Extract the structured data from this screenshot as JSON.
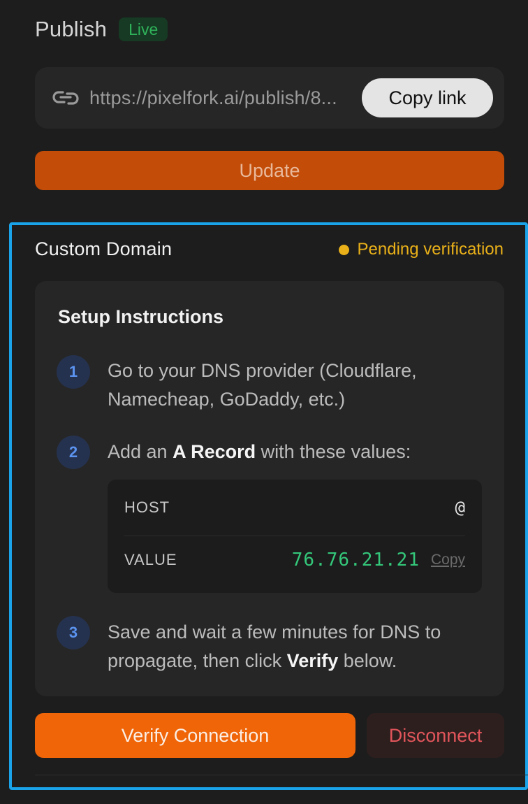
{
  "publish": {
    "title": "Publish",
    "status_badge": "Live",
    "url": "https://pixelfork.ai/publish/8...",
    "copy_link_label": "Copy link",
    "update_label": "Update",
    "link_icon": "link-chain-icon"
  },
  "custom_domain": {
    "title": "Custom Domain",
    "status": "Pending verification",
    "status_color": "#e9b019",
    "setup": {
      "title": "Setup Instructions",
      "steps": [
        {
          "number": "1",
          "text": "Go to your DNS provider (Cloudflare, Namecheap, GoDaddy, etc.)"
        },
        {
          "number": "2",
          "text_before": "Add an ",
          "text_bold": "A Record",
          "text_after": " with these values:"
        },
        {
          "number": "3",
          "text_before": "Save and wait a few minutes for DNS to propagate, then click ",
          "text_bold": "Verify",
          "text_after": " below."
        }
      ],
      "dns_record": {
        "host_label": "HOST",
        "host_value": "@",
        "value_label": "VALUE",
        "value": "76.76.21.21",
        "copy_label": "Copy"
      }
    },
    "verify_label": "Verify Connection",
    "disconnect_label": "Disconnect"
  },
  "colors": {
    "accent_orange": "#ef6508",
    "live_green": "#2fb25a",
    "ip_green": "#34c77a",
    "danger_red": "#e0555a",
    "selection_blue": "#1aa3e8"
  }
}
